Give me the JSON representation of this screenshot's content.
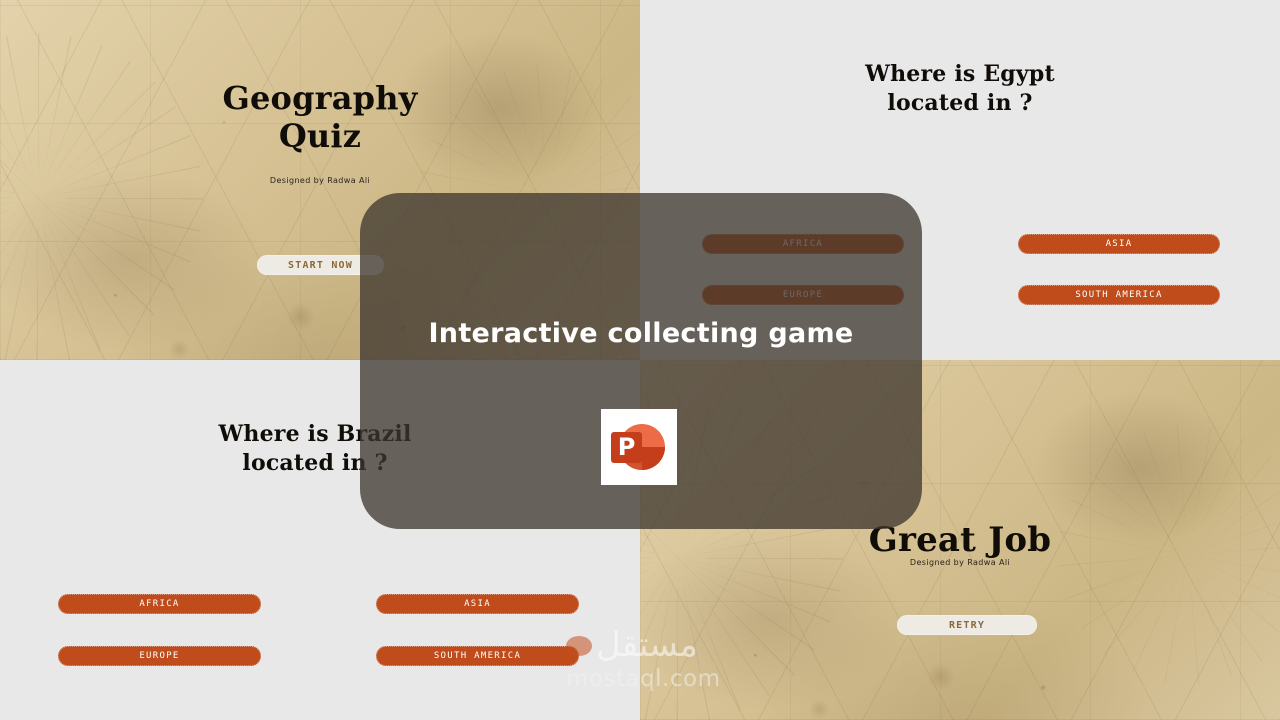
{
  "overlay": {
    "title": "Interactive collecting game",
    "icon": "powerpoint-file-icon",
    "panel_color": "#3E362E"
  },
  "theme": {
    "answer_button_color": "#BF4C1A",
    "ghost_button_color": "#EEEAE4",
    "ghost_button_text_color": "#8A6A3C",
    "plain_slide_background": "#E8E8E8",
    "parchment_background": "#D8C49A",
    "heading_color": "#100D09"
  },
  "slides": [
    {
      "name": "cover",
      "title_line1": "Geography",
      "title_line2": "Quiz",
      "byline": "Designed by Radwa Ali",
      "cta_label": "Start Now"
    },
    {
      "name": "question-egypt",
      "question_line1": "Where is Egypt",
      "question_line2": "located in ?",
      "answers": [
        "Africa",
        "Asia",
        "Europe",
        "South America"
      ]
    },
    {
      "name": "question-brazil",
      "question_line1": "Where is Brazil",
      "question_line2": "located in ?",
      "answers": [
        "Africa",
        "Asia",
        "Europe",
        "South America"
      ]
    },
    {
      "name": "result",
      "title": "Great Job",
      "byline": "Designed by Radwa Ali",
      "cta_label": "Retry"
    }
  ],
  "watermark": {
    "arabic": "مستقل",
    "latin": "mostaql.com"
  }
}
